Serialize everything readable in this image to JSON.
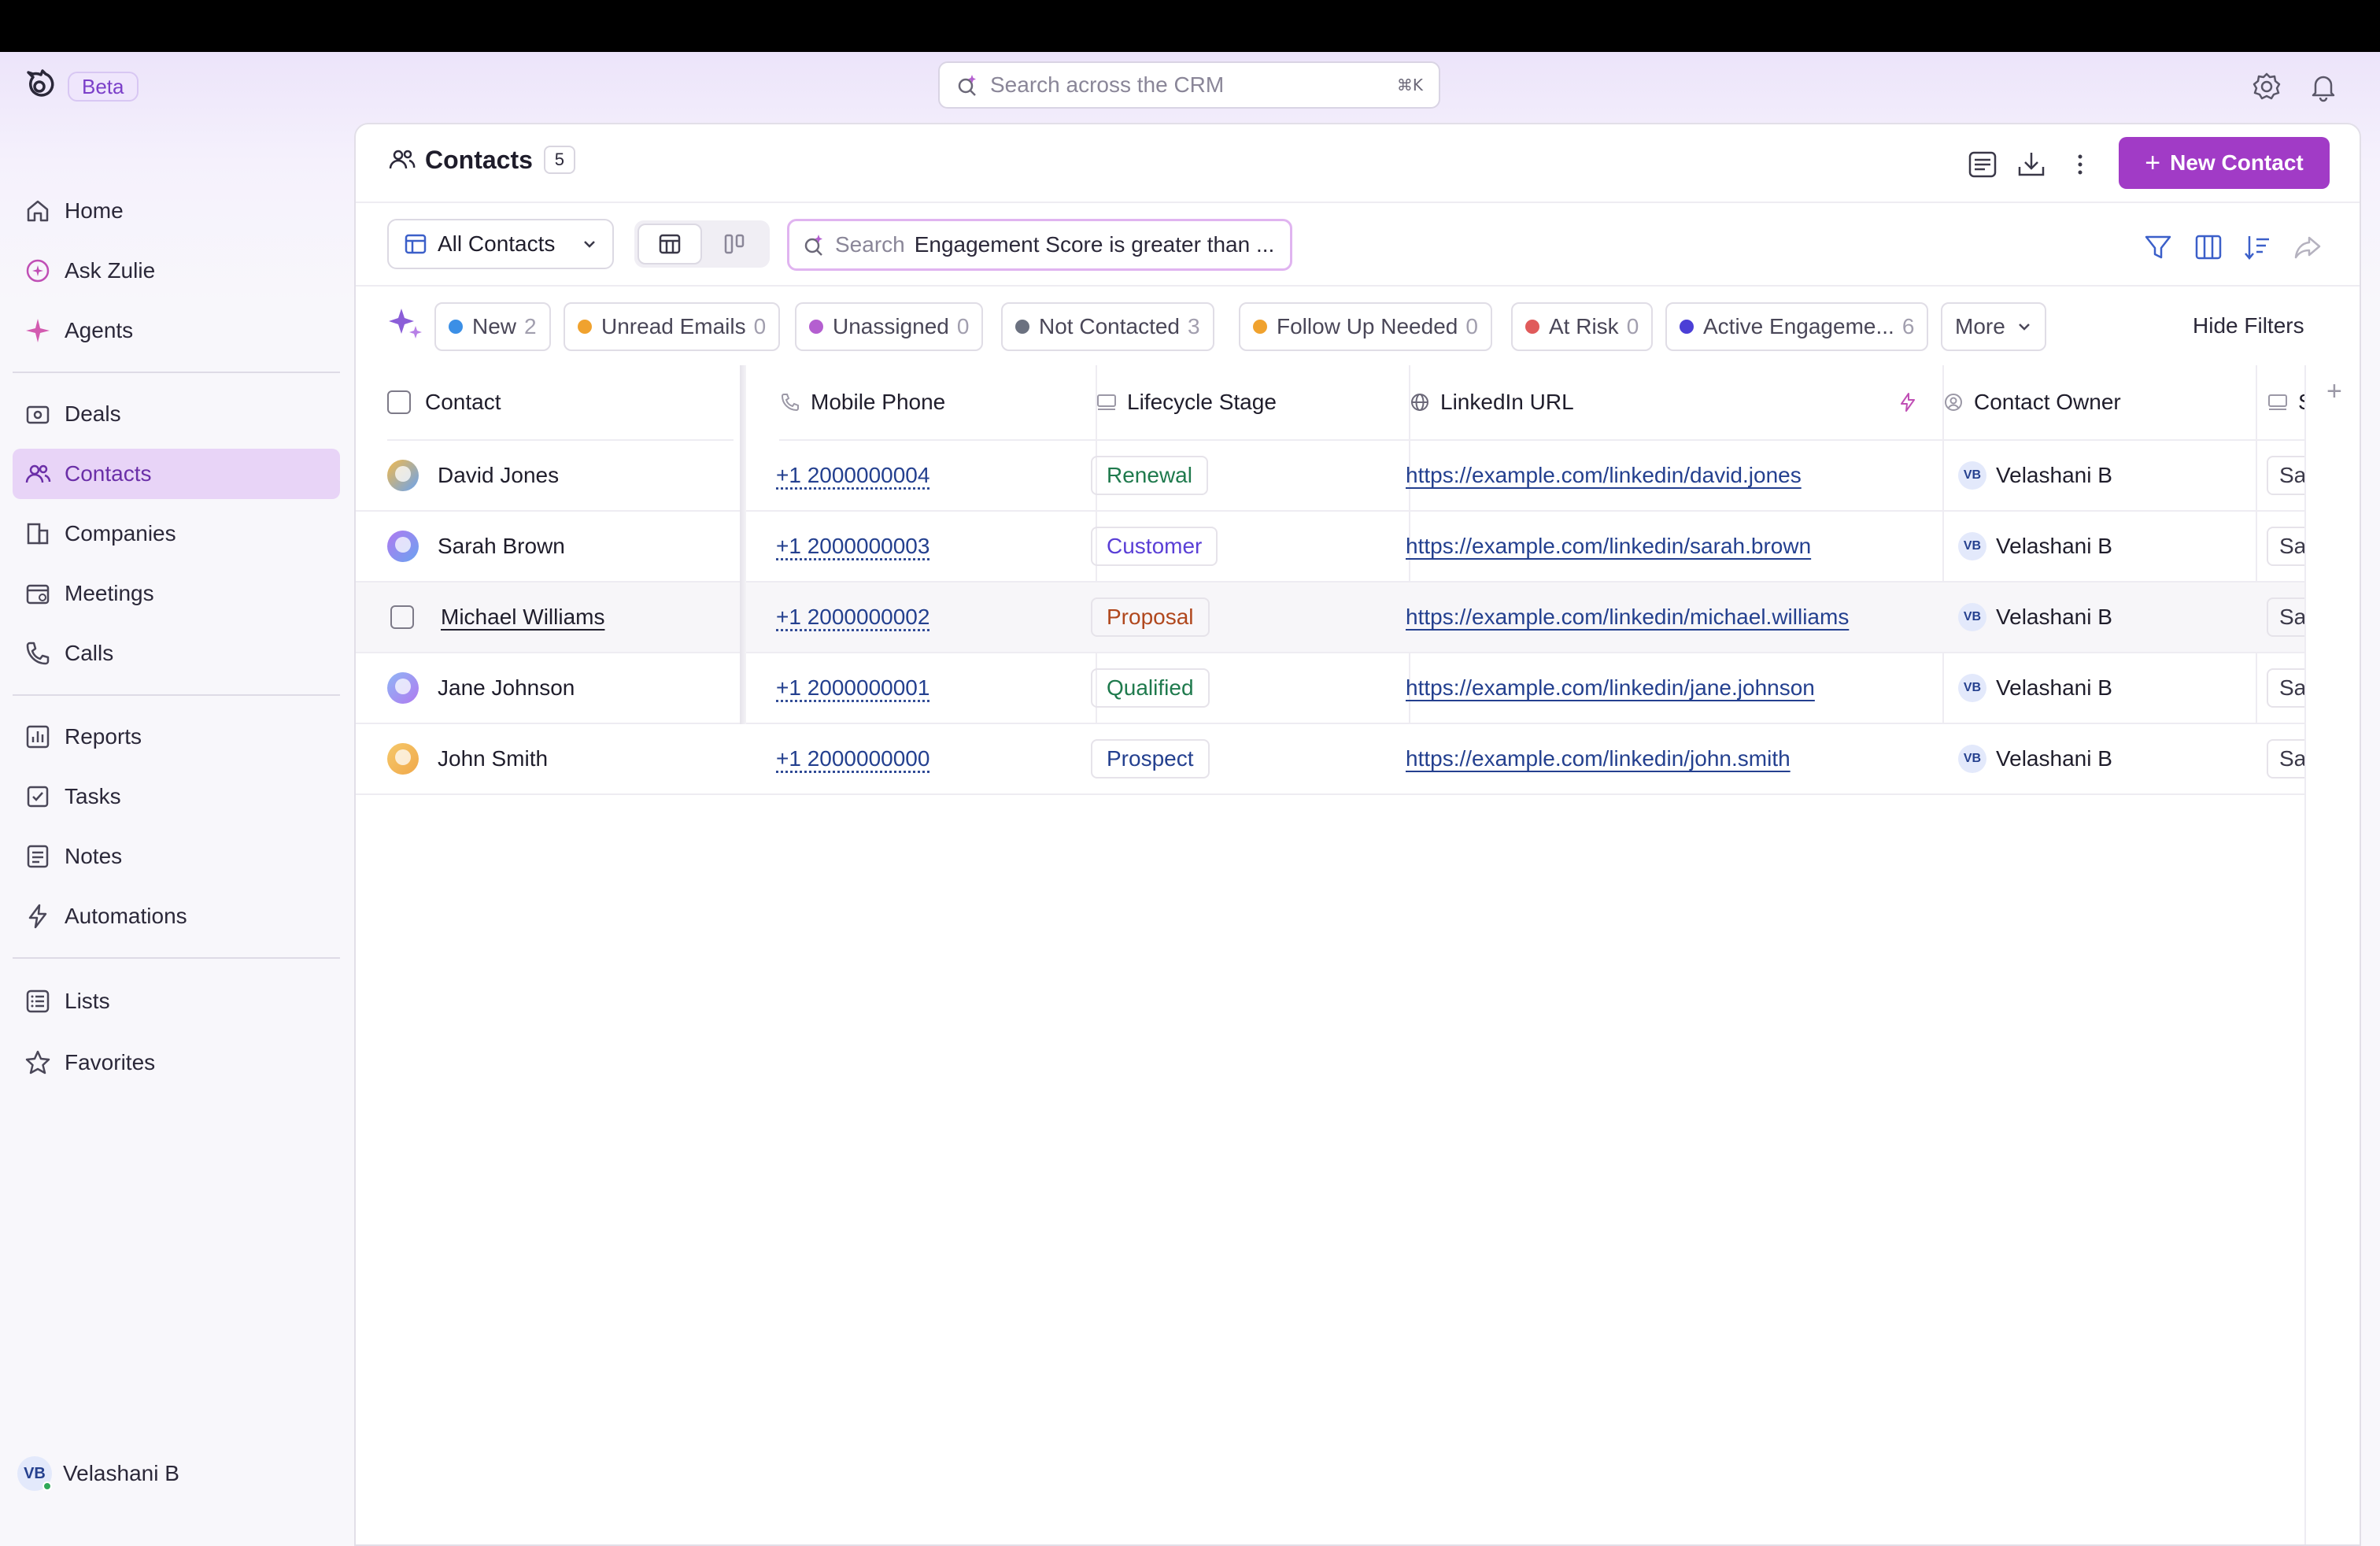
{
  "header": {
    "beta_label": "Beta",
    "search_placeholder": "Search across the CRM",
    "search_shortcut": "⌘K"
  },
  "sidebar": {
    "items": [
      {
        "label": "Home",
        "icon": "home-icon"
      },
      {
        "label": "Ask Zulie",
        "icon": "ask-zulie-icon"
      },
      {
        "label": "Agents",
        "icon": "agents-sparkle-icon"
      },
      {
        "label": "Deals",
        "icon": "deals-icon"
      },
      {
        "label": "Contacts",
        "icon": "contacts-icon",
        "active": true
      },
      {
        "label": "Companies",
        "icon": "companies-icon"
      },
      {
        "label": "Meetings",
        "icon": "meetings-icon"
      },
      {
        "label": "Calls",
        "icon": "phone-icon"
      },
      {
        "label": "Reports",
        "icon": "reports-icon"
      },
      {
        "label": "Tasks",
        "icon": "tasks-icon"
      },
      {
        "label": "Notes",
        "icon": "notes-icon"
      },
      {
        "label": "Automations",
        "icon": "lightning-icon"
      },
      {
        "label": "Lists",
        "icon": "lists-icon"
      },
      {
        "label": "Favorites",
        "icon": "star-icon"
      }
    ],
    "user": {
      "initials": "VB",
      "name": "Velashani B"
    }
  },
  "page": {
    "title": "Contacts",
    "count": "5",
    "new_button_label": "New Contact",
    "accent_color": "#a13bc6"
  },
  "toolbar": {
    "view_label": "All Contacts",
    "filter_search_label": "Search",
    "filter_search_value": "Engagement Score is greater than ..."
  },
  "filters": {
    "chips": [
      {
        "label": "New",
        "count": "2",
        "color": "#3b8fe6"
      },
      {
        "label": "Unread Emails",
        "count": "0",
        "color": "#f0a22e"
      },
      {
        "label": "Unassigned",
        "count": "0",
        "color": "#b45fd0"
      },
      {
        "label": "Not Contacted",
        "count": "3",
        "color": "#6b7180"
      },
      {
        "label": "Follow Up Needed",
        "count": "0",
        "color": "#f0a22e"
      },
      {
        "label": "At Risk",
        "count": "0",
        "color": "#e05b5b"
      },
      {
        "label": "Active Engageme...",
        "count": "6",
        "color": "#4b3fd6"
      }
    ],
    "more_label": "More",
    "hide_label": "Hide Filters"
  },
  "table": {
    "columns": [
      "Contact",
      "Mobile Phone",
      "Lifecycle Stage",
      "LinkedIn URL",
      "Contact Owner",
      "S"
    ],
    "rows": [
      {
        "name": "David Jones",
        "phone": "+1 2000000004",
        "stage": "Renewal",
        "linkedin": "https://example.com/linkedin/david.jones",
        "owner": "Velashani B",
        "owner_initials": "VB",
        "extra": "San"
      },
      {
        "name": "Sarah Brown",
        "phone": "+1 2000000003",
        "stage": "Customer",
        "linkedin": "https://example.com/linkedin/sarah.brown",
        "owner": "Velashani B",
        "owner_initials": "VB",
        "extra": "San"
      },
      {
        "name": "Michael Williams",
        "phone": "+1 2000000002",
        "stage": "Proposal",
        "linkedin": "https://example.com/linkedin/michael.williams",
        "owner": "Velashani B",
        "owner_initials": "VB",
        "extra": "San"
      },
      {
        "name": "Jane Johnson",
        "phone": "+1 2000000001",
        "stage": "Qualified",
        "linkedin": "https://example.com/linkedin/jane.johnson",
        "owner": "Velashani B",
        "owner_initials": "VB",
        "extra": "San"
      },
      {
        "name": "John Smith",
        "phone": "+1 2000000000",
        "stage": "Prospect",
        "linkedin": "https://example.com/linkedin/john.smith",
        "owner": "Velashani B",
        "owner_initials": "VB",
        "extra": "San"
      }
    ],
    "stage_colors": {
      "Renewal": "#1f7a4d",
      "Customer": "#5a3fd6",
      "Proposal": "#b0471d",
      "Qualified": "#1f7a4d",
      "Prospect": "#24408f"
    }
  }
}
